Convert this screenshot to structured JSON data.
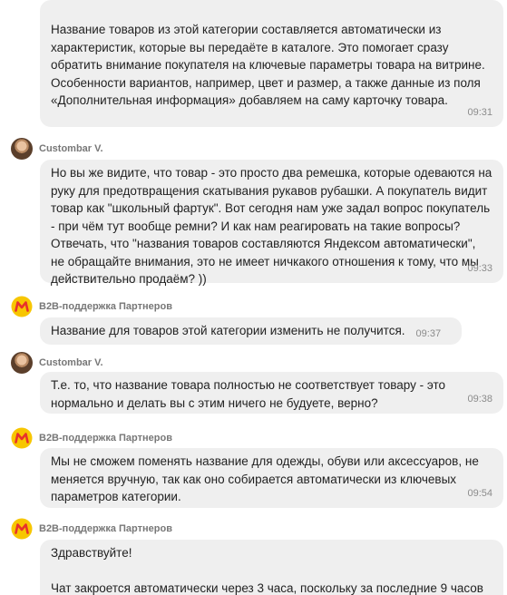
{
  "messages": [
    {
      "text": "Название товаров из этой категории составляется автоматически из характеристик, которые вы передаёте в каталоге. Это помогает сразу обратить внимание покупателя на ключевые параметры товара на витрине. Особенности вариантов, например, цвет и размер, а также данные из поля «Дополнительная информация» добавляем на саму карточку товара.",
      "time": "09:31"
    },
    {
      "sender": "Custombar V.",
      "text": "Но вы же видите, что товар - это просто два ремешка, которые одеваются на руку для предотвращения скатывания рукавов рубашки. А покупатель видит товар как \"школьный фартук\". Вот сегодня нам уже задал вопрос покупатель - при чём тут вообще ремни? И как нам реагировать на такие вопросы? Отвечать, что \"названия товаров составляются Яндексом автоматически\", не обращайте внимания, это не имеет ничкакого отношения к тому, что мы действительно продаём? ))",
      "time": "09:33"
    },
    {
      "sender": "B2B-поддержка Партнеров",
      "text": "Название для товаров этой категории изменить не получится.",
      "time": "09:37"
    },
    {
      "sender": "Custombar V.",
      "text": "Т.е. то, что название товара полностью не соответствует товару - это нормально и делать вы с этим ничего не будуете, верно?",
      "time": "09:38"
    },
    {
      "sender": "B2B-поддержка Партнеров",
      "text": "Мы не сможем поменять название для одежды, обуви или аксессуаров, не меняется вручную, так как оно собирается автоматически из ключевых параметров категории.",
      "time": "09:54"
    },
    {
      "sender": "B2B-поддержка Партнеров",
      "text": "Здравствуйте!\n\nЧат закроется автоматически через 3 часа, поскольку за последние 9 часов"
    }
  ],
  "icons": {
    "user_avatar": "user-photo-avatar",
    "support_avatar": "yandex-market-logo",
    "brand_color": "#f7c600",
    "brand_accent": "#e8322b"
  }
}
